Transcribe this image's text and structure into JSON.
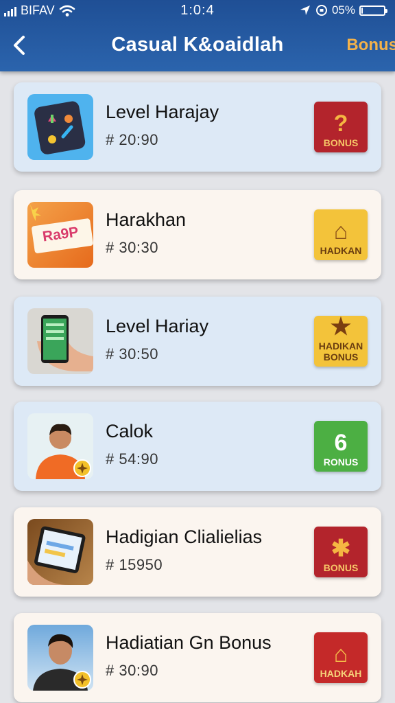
{
  "status_bar": {
    "carrier": "BIFAV",
    "time": "1:0:4",
    "battery": "05%",
    "battery_level": 0.05
  },
  "header": {
    "title": "Casual K&oaidlah",
    "right_link": "Bonus"
  },
  "items": [
    {
      "title": "Level Harajay",
      "score": "20:90",
      "badge": {
        "glyph": "?",
        "label": "BONUS"
      },
      "thumb_text": ""
    },
    {
      "title": "Harakhan",
      "score": "30:30",
      "badge": {
        "glyph": "⌂",
        "label": "HADKAN"
      },
      "thumb_text": "Ra9P"
    },
    {
      "title": "Level Hariay",
      "score": "30:50",
      "badge": {
        "glyph": "★",
        "label": "HADIKAN BONUS"
      },
      "thumb_text": ""
    },
    {
      "title": "Calok",
      "score": "54:90",
      "badge": {
        "glyph": "6",
        "label": "RONUS"
      },
      "thumb_text": ""
    },
    {
      "title": "Hadigian Clialielias",
      "score": "15950",
      "badge": {
        "glyph": "✱",
        "label": "BONUS"
      },
      "thumb_text": ""
    },
    {
      "title": "Hadiatian Gn Bonus",
      "score": "30:90",
      "badge": {
        "glyph": "⌂",
        "label": "HADKAH"
      },
      "thumb_text": ""
    }
  ],
  "score_prefix": "#",
  "colors": {
    "header": "#2b64ad",
    "accent": "#f4b24a"
  },
  "icons": [
    "back-chevron-icon",
    "wifi-icon",
    "location-icon",
    "lock-rotation-icon",
    "battery-icon"
  ]
}
